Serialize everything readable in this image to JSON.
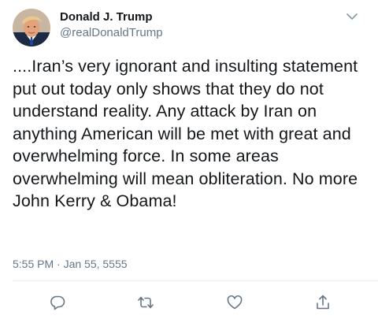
{
  "author": {
    "display_name": "Donald J. Trump",
    "handle": "@realDonaldTrump",
    "avatar_icon": "profile-photo"
  },
  "tweet": {
    "text": "....Iran’s very ignorant and insulting statement put out today only shows that they do not understand reality. Any attack by Iran on anything American will be met with great and overwhelming force. In some areas overwhelming will mean obliteration. No more John Kerry & Obama!",
    "timestamp": "5:55 PM · Jan 55, 5555"
  },
  "actions": {
    "reply_icon": "reply-icon",
    "retweet_icon": "retweet-icon",
    "like_icon": "like-icon",
    "share_icon": "share-icon"
  },
  "colors": {
    "text_primary": "#14171a",
    "text_secondary": "#657786",
    "icon": "#657786",
    "divider": "#e6ecf0"
  }
}
